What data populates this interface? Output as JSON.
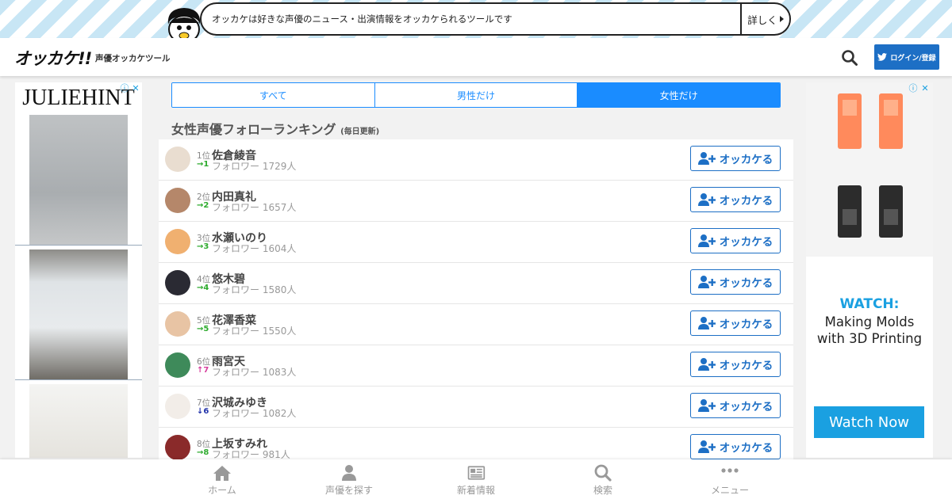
{
  "banner": {
    "message": "オッカケは好きな声優のニュース・出演情報をオッカケられるツールです",
    "more": "詳しく"
  },
  "header": {
    "logo": "オッカケ!!",
    "tagline": "声優オッカケツール",
    "login": "ログイン/登録"
  },
  "ad_left": {
    "brand": "JULIEHINT"
  },
  "ad_right": {
    "watch": "WATCH:",
    "line1": "Making Molds",
    "line2": "with 3D Printing",
    "cta": "Watch Now"
  },
  "tabs": [
    {
      "label": "すべて",
      "active": false
    },
    {
      "label": "男性だけ",
      "active": false
    },
    {
      "label": "女性だけ",
      "active": true
    }
  ],
  "ranking": {
    "title": "女性声優フォローランキング",
    "note": "(毎日更新)",
    "follow_label": "オッカケる",
    "items": [
      {
        "rank": "1位",
        "name": "佐倉綾音",
        "trend": "→1",
        "trend_color": "#2eab2e",
        "followers": "フォロワー 1729人",
        "avatar": "#e9ddd0"
      },
      {
        "rank": "2位",
        "name": "内田真礼",
        "trend": "→2",
        "trend_color": "#2eab2e",
        "followers": "フォロワー 1657人",
        "avatar": "#b5876a"
      },
      {
        "rank": "3位",
        "name": "水瀬いのり",
        "trend": "→3",
        "trend_color": "#2eab2e",
        "followers": "フォロワー 1604人",
        "avatar": "#f0b070"
      },
      {
        "rank": "4位",
        "name": "悠木碧",
        "trend": "→4",
        "trend_color": "#2eab2e",
        "followers": "フォロワー 1580人",
        "avatar": "#2a2a33"
      },
      {
        "rank": "5位",
        "name": "花澤香菜",
        "trend": "→5",
        "trend_color": "#2eab2e",
        "followers": "フォロワー 1550人",
        "avatar": "#e8c4a4"
      },
      {
        "rank": "6位",
        "name": "雨宮天",
        "trend": "↑7",
        "trend_color": "#d63c9c",
        "followers": "フォロワー 1083人",
        "avatar": "#3e8a5a"
      },
      {
        "rank": "7位",
        "name": "沢城みゆき",
        "trend": "↓6",
        "trend_color": "#2233aa",
        "followers": "フォロワー 1082人",
        "avatar": "#f2ede8"
      },
      {
        "rank": "8位",
        "name": "上坂すみれ",
        "trend": "→8",
        "trend_color": "#2eab2e",
        "followers": "フォロワー 981人",
        "avatar": "#8a2a2a"
      }
    ]
  },
  "nav": [
    {
      "label": "ホーム",
      "icon": "home-icon"
    },
    {
      "label": "声優を探す",
      "icon": "person-icon"
    },
    {
      "label": "新着情報",
      "icon": "news-icon"
    },
    {
      "label": "検索",
      "icon": "search-icon"
    },
    {
      "label": "メニュー",
      "icon": "menu-icon"
    }
  ]
}
